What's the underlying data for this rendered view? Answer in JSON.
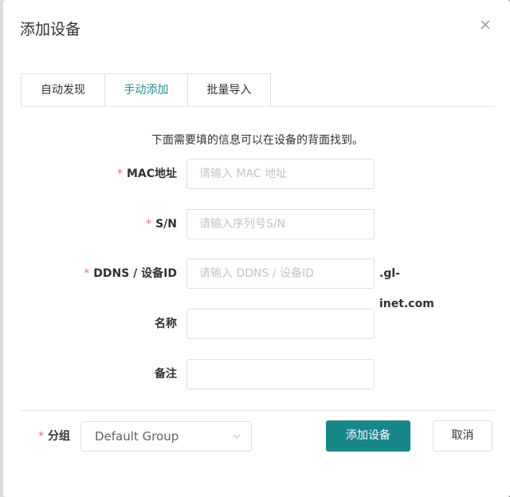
{
  "dialog": {
    "title": "添加设备",
    "close_icon": "close-icon"
  },
  "tabs": [
    {
      "label": "自动发现",
      "active": false
    },
    {
      "label": "手动添加",
      "active": true
    },
    {
      "label": "批量导入",
      "active": false
    }
  ],
  "hint": "下面需要填的信息可以在设备的背面找到。",
  "fields": {
    "mac": {
      "label": "MAC地址",
      "required_mark": "*",
      "placeholder": "请输入 MAC 地址"
    },
    "sn": {
      "label": "S/N",
      "required_mark": "*",
      "placeholder": "请输入序列号S/N"
    },
    "ddns": {
      "label": "DDNS / 设备ID",
      "required_mark": "*",
      "placeholder": "请输入 DDNS / 设备ID",
      "suffix": ".gl-inet.com"
    },
    "name": {
      "label": "名称"
    },
    "note": {
      "label": "备注"
    }
  },
  "footer": {
    "group_label": "分组",
    "group_required_mark": "*",
    "group_value": "Default Group",
    "add_button": "添加设备",
    "cancel_button": "取消"
  },
  "colors": {
    "accent": "#17878a",
    "required": "#f56c6c"
  }
}
